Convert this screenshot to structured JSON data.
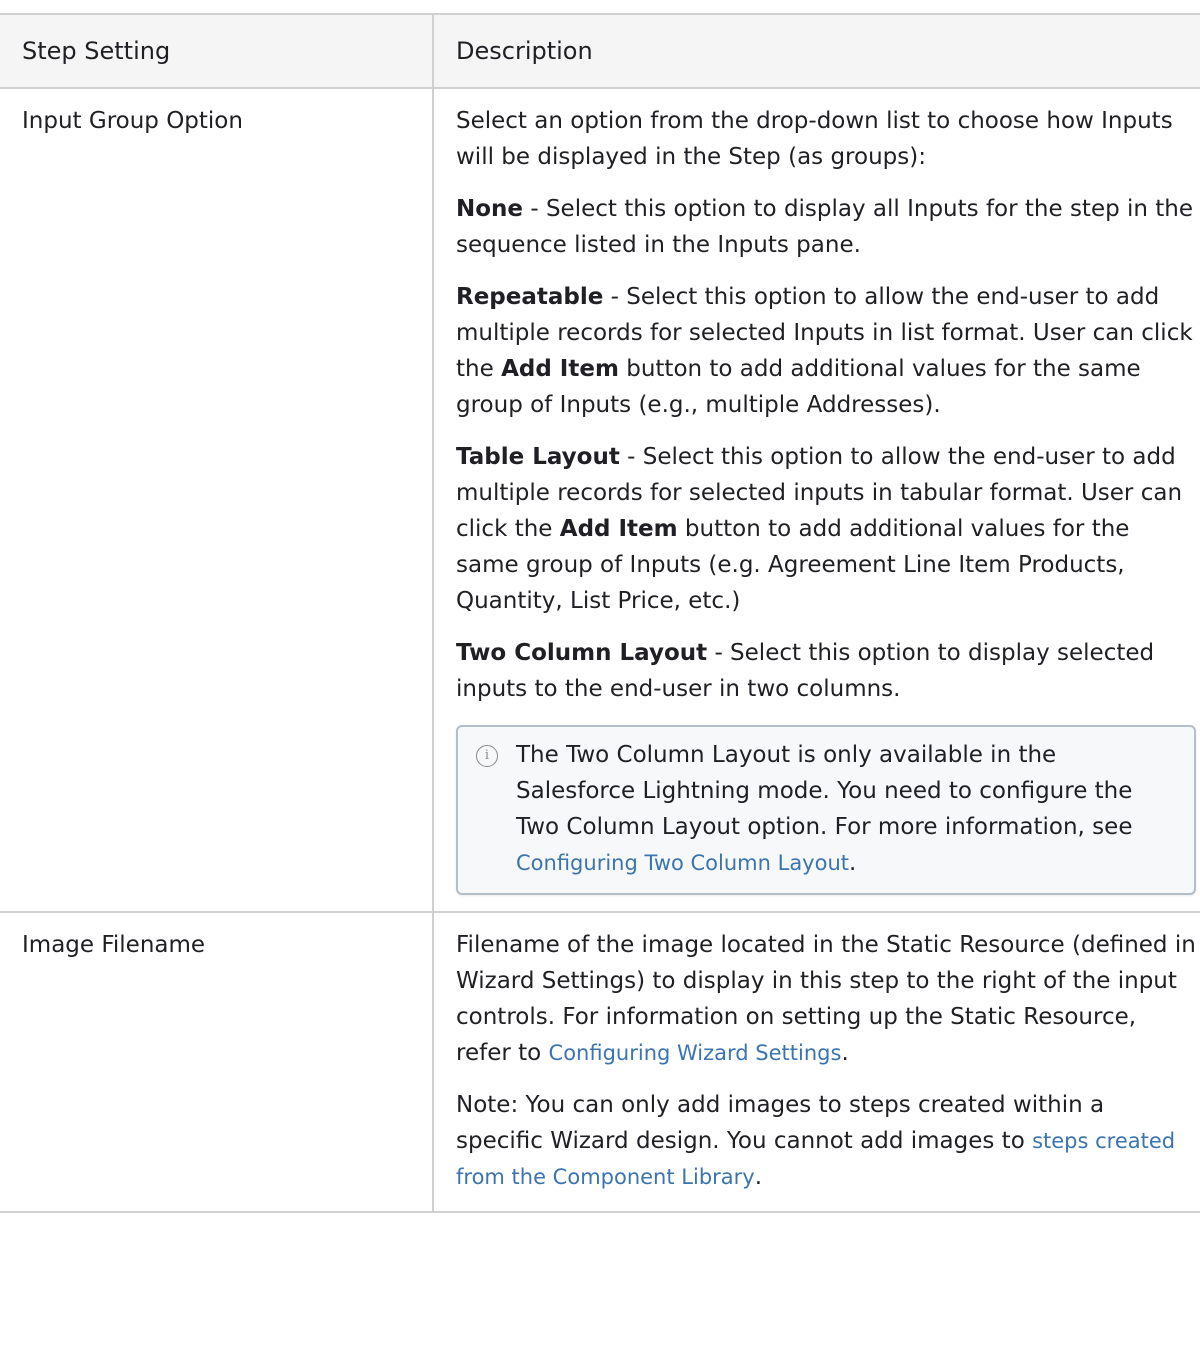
{
  "table": {
    "headers": [
      "Step Setting",
      "Description"
    ],
    "rows": [
      {
        "setting": "Input Group Option",
        "intro": "Select an option from the drop-down list to choose how Inputs will be displayed in the Step (as groups):",
        "options": [
          {
            "name": "None",
            "text": " - Select this option to display all Inputs for the step in the sequence listed in the Inputs pane."
          },
          {
            "name": "Repeatable",
            "text_before": " - Select this option to allow the end-user to add multiple records for selected Inputs in list format. User can click the ",
            "bold_inline": "Add Item",
            "text_after": " button to add additional values for the same group of Inputs (e.g., multiple Addresses)."
          },
          {
            "name": "Table Layout",
            "text_before": " - Select this option to allow the end-user to add multiple records for selected inputs in tabular format. User can click the ",
            "bold_inline": "Add Item",
            "text_after": " button to add additional values for the same group of Inputs (e.g. Agreement Line Item Products, Quantity, List Price, etc.)"
          },
          {
            "name": "Two Column Layout",
            "text": " - Select this option to display selected inputs to the end-user in two columns."
          }
        ],
        "note": {
          "icon": "info-icon",
          "text": "The Two Column Layout is only available in the Salesforce Lightning mode. You need to configure the Two Column Layout option. For more information, see ",
          "link": "Configuring Two Column Layout",
          "suffix": "."
        }
      },
      {
        "setting": "Image Filename",
        "description_before": "Filename of the image located in the Static Resource (defined in Wizard Settings) to display in this step to the right of the input controls. For information on setting up the Static Resource, refer to ",
        "description_link": "Configuring Wizard Settings",
        "description_after": ".",
        "note_before": "Note: You can only add images to steps created within a specific Wizard design. You cannot add images to ",
        "note_link": "steps created from the Component Library",
        "note_after": "."
      }
    ]
  },
  "colors": {
    "link": "#3b74b0",
    "border": "#d0d0d0",
    "header_bg": "#f5f5f5"
  }
}
